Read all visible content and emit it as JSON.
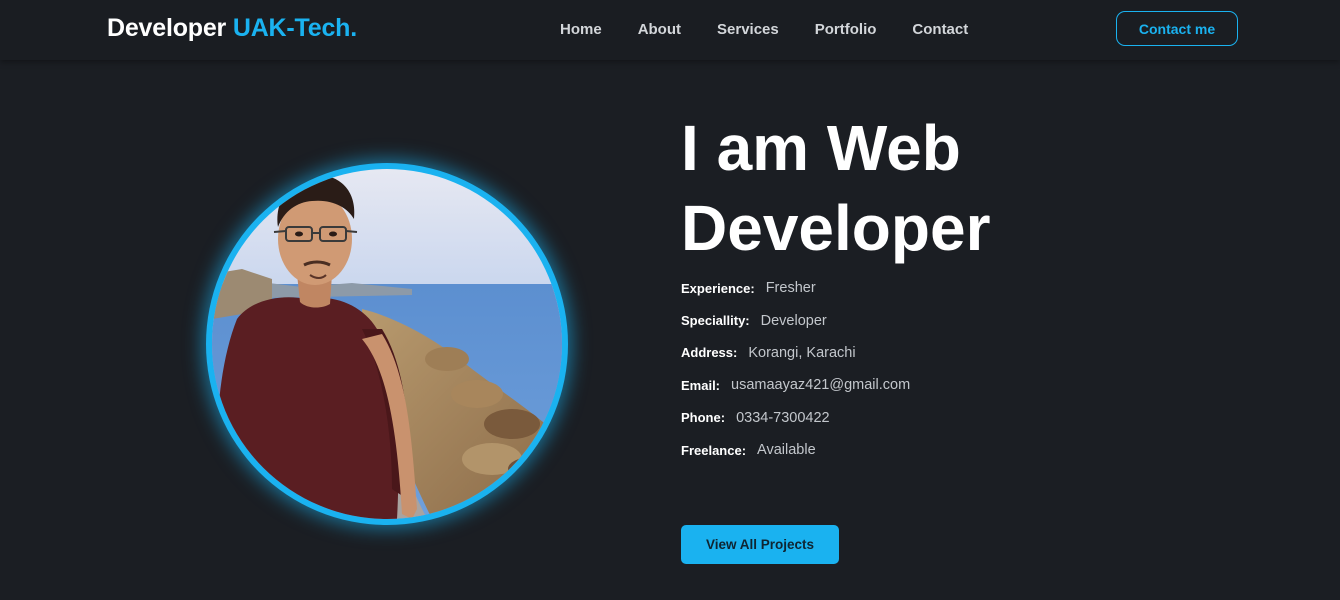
{
  "brand": {
    "main": "Developer",
    "accent": "UAK-Tech."
  },
  "nav": {
    "items": [
      {
        "label": "Home"
      },
      {
        "label": "About"
      },
      {
        "label": "Services"
      },
      {
        "label": "Portfolio"
      },
      {
        "label": "Contact"
      }
    ],
    "contact_button": "Contact me"
  },
  "hero": {
    "title_line1": "I am Web",
    "title_line2": "Developer",
    "info": [
      {
        "label": "Experience:",
        "value": "Fresher"
      },
      {
        "label": "Speciallity:",
        "value": "Developer"
      },
      {
        "label": "Address:",
        "value": "Korangi, Karachi"
      },
      {
        "label": "Email:",
        "value": "usamaayaz421@gmail.com"
      },
      {
        "label": "Phone:",
        "value": "0334-7300422"
      },
      {
        "label": "Freelance:",
        "value": "Available"
      }
    ],
    "projects_button": "View All Projects"
  },
  "profile_photo": {
    "icon": "profile-photo"
  },
  "colors": {
    "accent": "#1ab2f0",
    "background": "#1b1e23",
    "navbar": "#1a1d22"
  }
}
